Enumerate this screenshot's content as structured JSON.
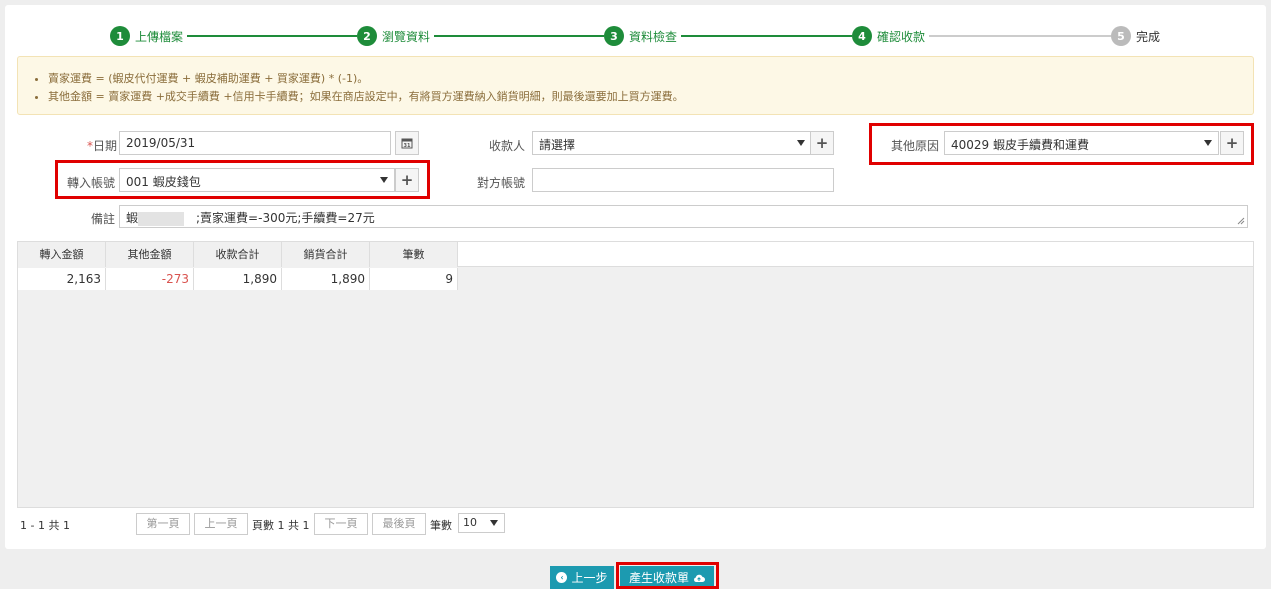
{
  "stepper": {
    "steps": [
      {
        "num": "1",
        "label": "上傳檔案"
      },
      {
        "num": "2",
        "label": "瀏覽資料"
      },
      {
        "num": "3",
        "label": "資料檢查"
      },
      {
        "num": "4",
        "label": "確認收款"
      },
      {
        "num": "5",
        "label": "完成"
      }
    ],
    "active_color": "#1e8c3a",
    "inactive_color": "#bbbbbb"
  },
  "notice": {
    "lines": [
      "賣家運費 = (蝦皮代付運費 + 蝦皮補助運費 + 買家運費) * (-1)。",
      "其他金額 = 賣家運費 +成交手續費 +信用卡手續費；如果在商店設定中，有將買方運費納入銷貨明細，則最後還要加上買方運費。"
    ]
  },
  "form": {
    "date": {
      "required_mark": "*",
      "label": "日期",
      "value": "2019/05/31"
    },
    "payee": {
      "label": "收款人",
      "value": "請選擇"
    },
    "other_reason": {
      "label": "其他原因",
      "value": "40029 蝦皮手續費和運費"
    },
    "deposit_account": {
      "label": "轉入帳號",
      "value": "001 蝦皮錢包"
    },
    "counter_account": {
      "label": "對方帳號",
      "value": ""
    },
    "note": {
      "label": "備註",
      "value_prefix": "蝦",
      "value": ";賣家運費=-300元;手續費=27元"
    }
  },
  "table": {
    "columns": [
      "轉入金額",
      "其他金額",
      "收款合計",
      "銷貨合計",
      "筆數"
    ],
    "rows": [
      [
        "2,163",
        "-273",
        "1,890",
        "1,890",
        "9"
      ]
    ]
  },
  "pager": {
    "summary": "1 - 1 共 1",
    "first": "第一頁",
    "prev": "上一頁",
    "page_info": "頁數 1 共 1",
    "next": "下一頁",
    "last": "最後頁",
    "rows_label": "筆數",
    "rows_value": "10"
  },
  "footer": {
    "back": "上一步",
    "generate": "產生收款單"
  },
  "colors": {
    "accent": "#1c9ab0",
    "highlight": "#e00000",
    "negative": "#d9534f"
  }
}
